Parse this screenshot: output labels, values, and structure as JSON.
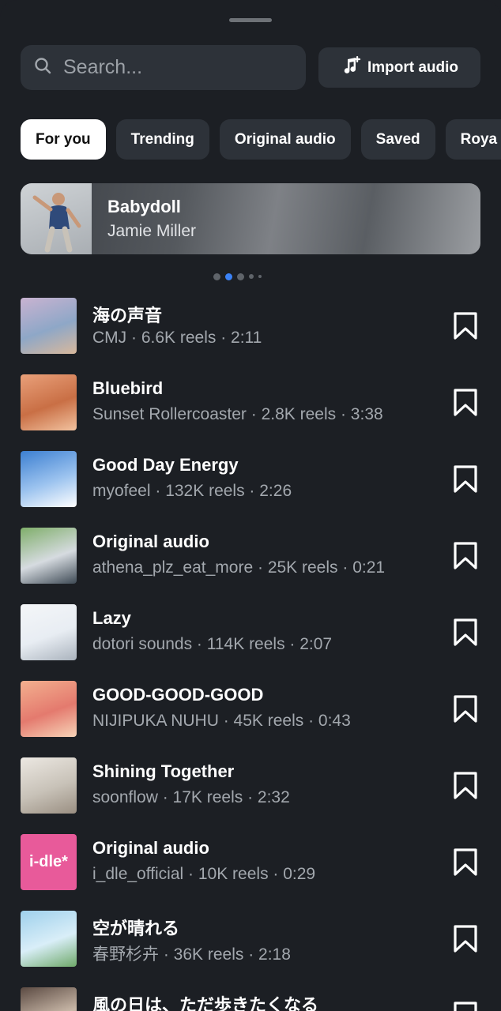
{
  "search": {
    "placeholder": "Search..."
  },
  "import_button": {
    "label": "Import audio"
  },
  "tabs": [
    {
      "label": "For you",
      "active": true
    },
    {
      "label": "Trending",
      "active": false
    },
    {
      "label": "Original audio",
      "active": false
    },
    {
      "label": "Saved",
      "active": false
    },
    {
      "label": "Roya",
      "active": false
    }
  ],
  "featured": {
    "title": "Babydoll",
    "artist": "Jamie Miller"
  },
  "carousel": {
    "page_count": 5,
    "current_page": 2
  },
  "tracks": [
    {
      "title": "海の声音",
      "meta": "CMJ · 6.6K reels · 2:11",
      "thumb_colors": [
        "#c9b3d1",
        "#8ea7c7",
        "#d8b89c"
      ],
      "thumb_text": ""
    },
    {
      "title": "Bluebird",
      "meta": "Sunset Rollercoaster · 2.8K reels · 3:38",
      "thumb_colors": [
        "#e9a07a",
        "#c96f45",
        "#f2c3a0"
      ],
      "thumb_text": ""
    },
    {
      "title": "Good Day Energy",
      "meta": "myofeel · 132K reels · 2:26",
      "thumb_colors": [
        "#3c7fd1",
        "#9cc3ef",
        "#ffffff"
      ],
      "thumb_text": ""
    },
    {
      "title": "Original audio",
      "meta": "athena_plz_eat_more · 25K reels · 0:21",
      "thumb_colors": [
        "#7fae6a",
        "#d6dbe0",
        "#3e4a55"
      ],
      "thumb_text": ""
    },
    {
      "title": "Lazy",
      "meta": "dotori sounds · 114K reels · 2:07",
      "thumb_colors": [
        "#f4f6f8",
        "#e8edf3",
        "#aab3bd"
      ],
      "thumb_text": ""
    },
    {
      "title": "GOOD-GOOD-GOOD",
      "meta": "NIJIPUKA NUHU · 45K reels · 0:43",
      "thumb_colors": [
        "#f3b08f",
        "#e47a6e",
        "#f7d4b8"
      ],
      "thumb_text": ""
    },
    {
      "title": "Shining Together",
      "meta": "soonflow · 17K reels · 2:32",
      "thumb_colors": [
        "#ece8e2",
        "#c8c2b8",
        "#9a8f82"
      ],
      "thumb_text": ""
    },
    {
      "title": "Original audio",
      "meta": "i_dle_official · 10K reels · 0:29",
      "thumb_colors": [
        "#e85a9a",
        "#e85a9a",
        "#e85a9a"
      ],
      "thumb_text": "i-dle*"
    },
    {
      "title": "空が晴れる",
      "meta": "春野杉卉 · 36K reels · 2:18",
      "thumb_colors": [
        "#9ed0ec",
        "#d9eef8",
        "#6fa96a"
      ],
      "thumb_text": ""
    },
    {
      "title": "風の日は、ただ歩きたくなる",
      "meta": "",
      "thumb_colors": [
        "#5b4a42",
        "#c9b8a8",
        "#2e2622"
      ],
      "thumb_text": ""
    }
  ]
}
